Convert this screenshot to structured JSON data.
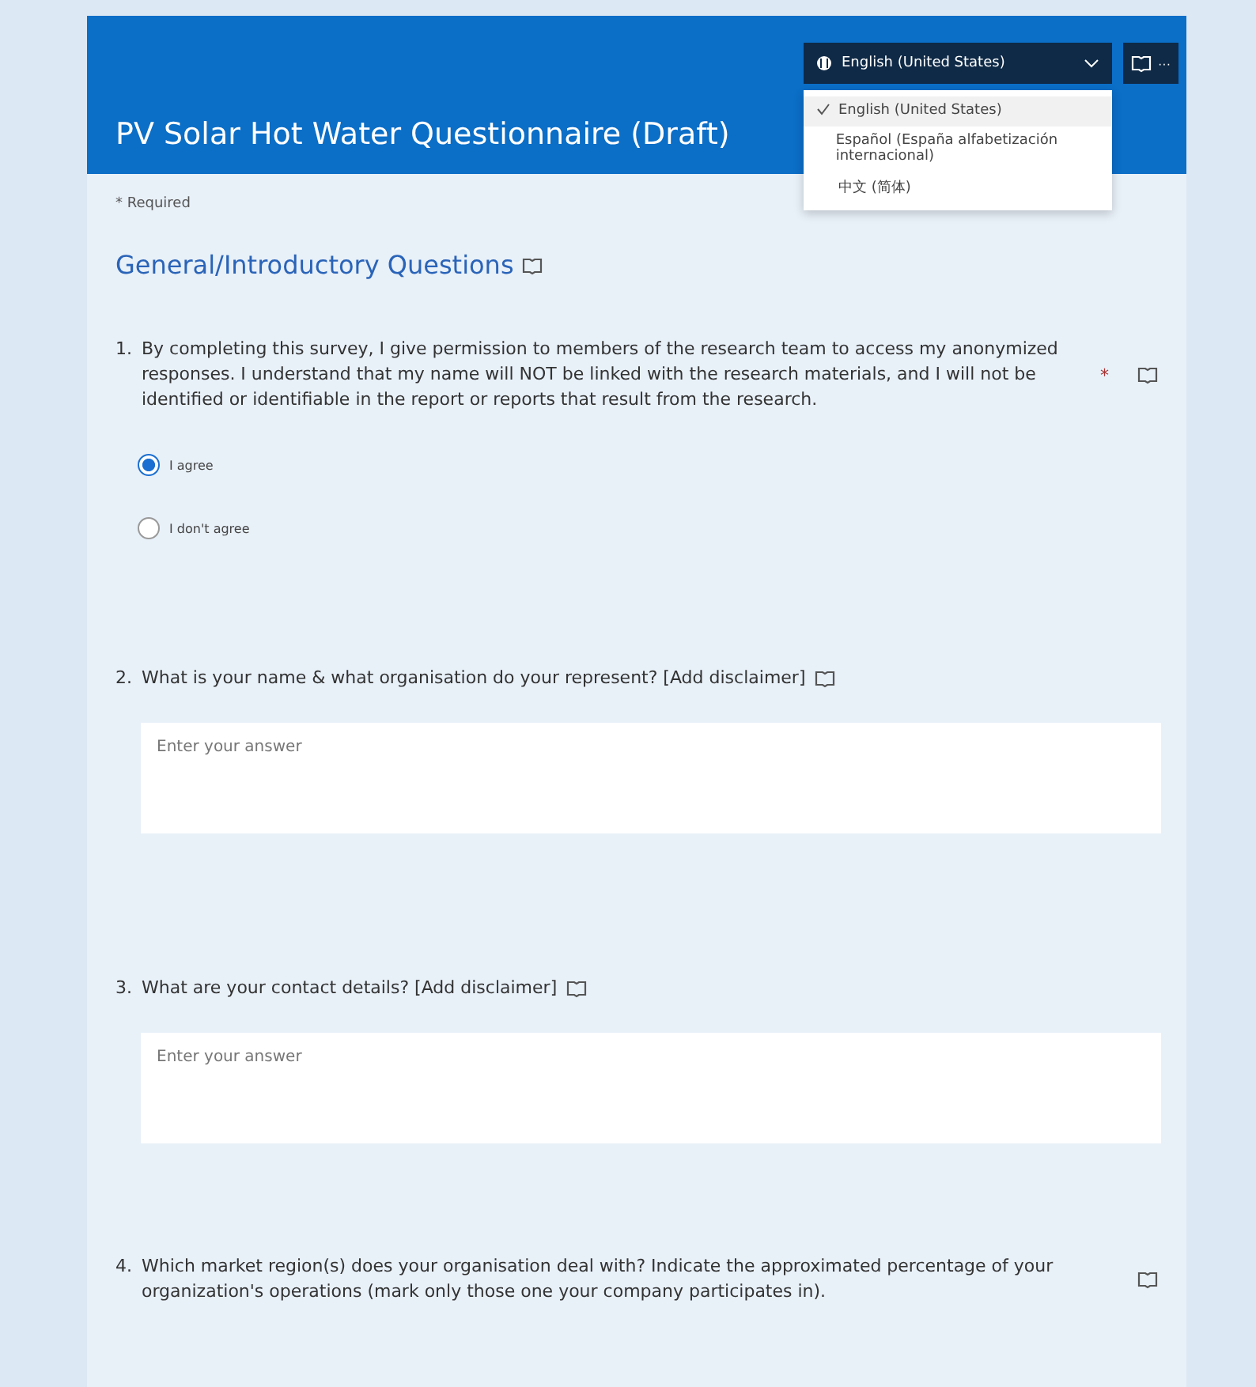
{
  "form": {
    "title": "PV Solar Hot Water Questionnaire (Draft)",
    "required_note": "* Required",
    "section_title": "General/Introductory Questions"
  },
  "language": {
    "current": "English (United States)",
    "options": [
      {
        "label": "English (United States)",
        "selected": true
      },
      {
        "label": "Español (España alfabetización internacional)",
        "selected": false
      },
      {
        "label": "中文 (简体)",
        "selected": false
      }
    ]
  },
  "more_button": "···",
  "questions": [
    {
      "kind": "choice",
      "number": "1.",
      "text": "By completing this survey, I give permission to members of the research team to access my anonymized responses. I understand that my name will NOT be linked with the research materials, and I will not be identified or identifiable in the report or reports that result from the research.",
      "required_mark": "*",
      "options": [
        {
          "label": "I agree",
          "selected": true
        },
        {
          "label": "I don't agree",
          "selected": false
        }
      ]
    },
    {
      "kind": "text",
      "number": "2.",
      "text": "What is your name & what organisation do your represent? [Add disclaimer]",
      "placeholder": "Enter your answer"
    },
    {
      "kind": "text",
      "number": "3.",
      "text": "What are your contact details? [Add disclaimer]",
      "placeholder": "Enter your answer"
    },
    {
      "kind": "open",
      "number": "4.",
      "text": "Which market region(s) does your organisation deal with? Indicate the approximated percentage of your organization's operations (mark only those one your company participates in)."
    }
  ]
}
